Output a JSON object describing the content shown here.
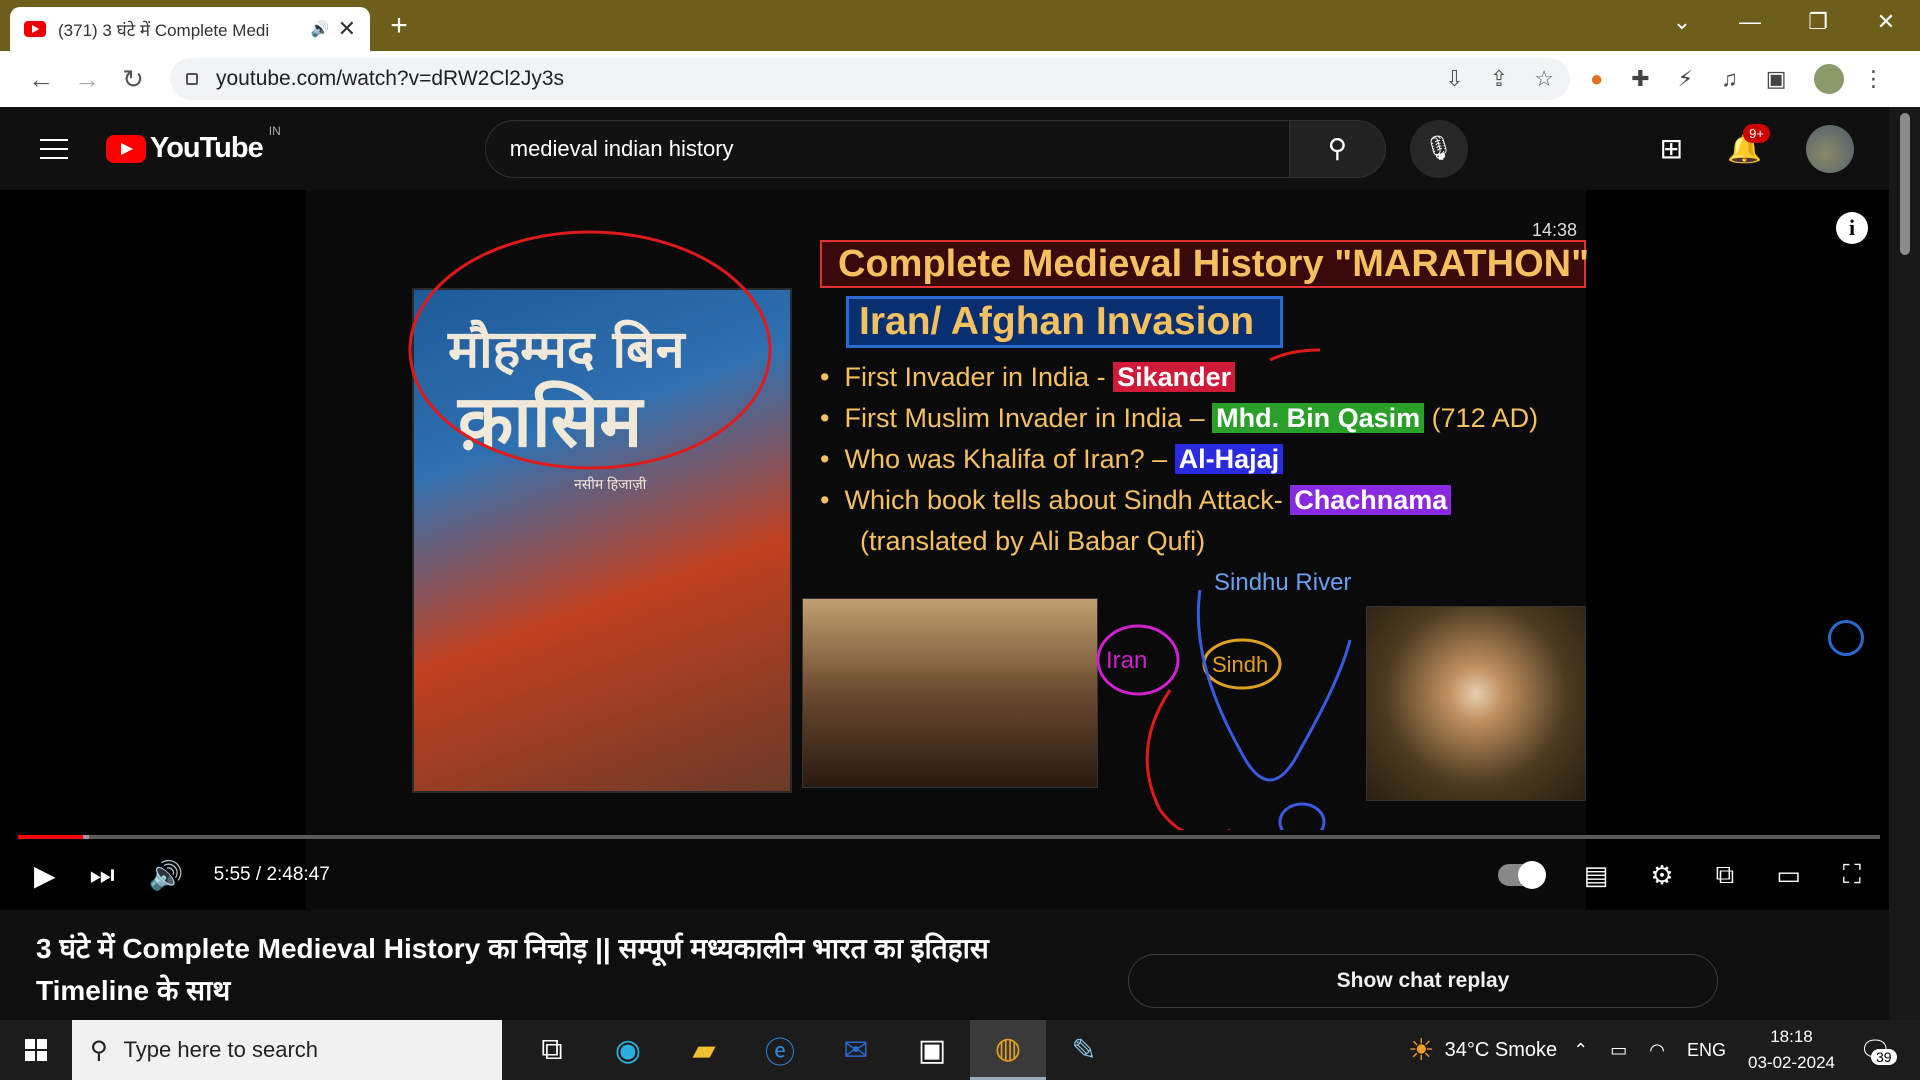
{
  "browser": {
    "tab_title": "(371) 3 घंटे में Complete Medi",
    "tab_audio_icon": "speaker-icon",
    "url": "youtube.com/watch?v=dRW2Cl2Jy3s"
  },
  "youtube": {
    "logo_text": "YouTube",
    "country_code": "IN",
    "search_query": "medieval indian history",
    "notification_badge": "9+"
  },
  "video": {
    "slide_title": "Complete Medieval History \"MARATHON\"",
    "slide_subtitle": "Iran/ Afghan Invasion",
    "slide_timestamp": "14:38",
    "bullets": [
      {
        "text": "First Invader in India - ",
        "highlight": "Sikander",
        "suffix": "",
        "color": "#d01a3a"
      },
      {
        "text": "First Muslim Invader in India – ",
        "highlight": "Mhd. Bin Qasim",
        "suffix": " (712 AD)",
        "color": "#2aa02a"
      },
      {
        "text": "Who was Khalifa of Iran? – ",
        "highlight": "Al-Hajaj",
        "suffix": "",
        "color": "#2a2ae0"
      },
      {
        "text": "Which book tells about Sindh Attack- ",
        "highlight": "Chachnama",
        "suffix": "",
        "color": "#8a2ae0"
      }
    ],
    "bullet_note": "(translated by Ali Babar Qufi)",
    "book_title_line1": "मौहम्मद बिन",
    "book_title_line2": "क़ासिम",
    "book_author": "नसीम हिजाज़ी",
    "annotation_river": "Sindhu River",
    "annotation_iran": "Iran",
    "annotation_sindh": "Sindh",
    "current_time": "5:55",
    "duration": "2:48:47",
    "played_fraction": 0.035,
    "loaded_fraction": 0.038
  },
  "page": {
    "video_title": "3 घंटे में Complete Medieval History का निचोड़ || सम्पूर्ण मध्यकालीन भारत का इतिहास Timeline के साथ",
    "chat_button": "Show chat replay"
  },
  "taskbar": {
    "search_placeholder": "Type here to search",
    "weather": "34°C  Smoke",
    "language": "ENG",
    "time": "18:18",
    "date": "03-02-2024",
    "notification_count": "39"
  }
}
